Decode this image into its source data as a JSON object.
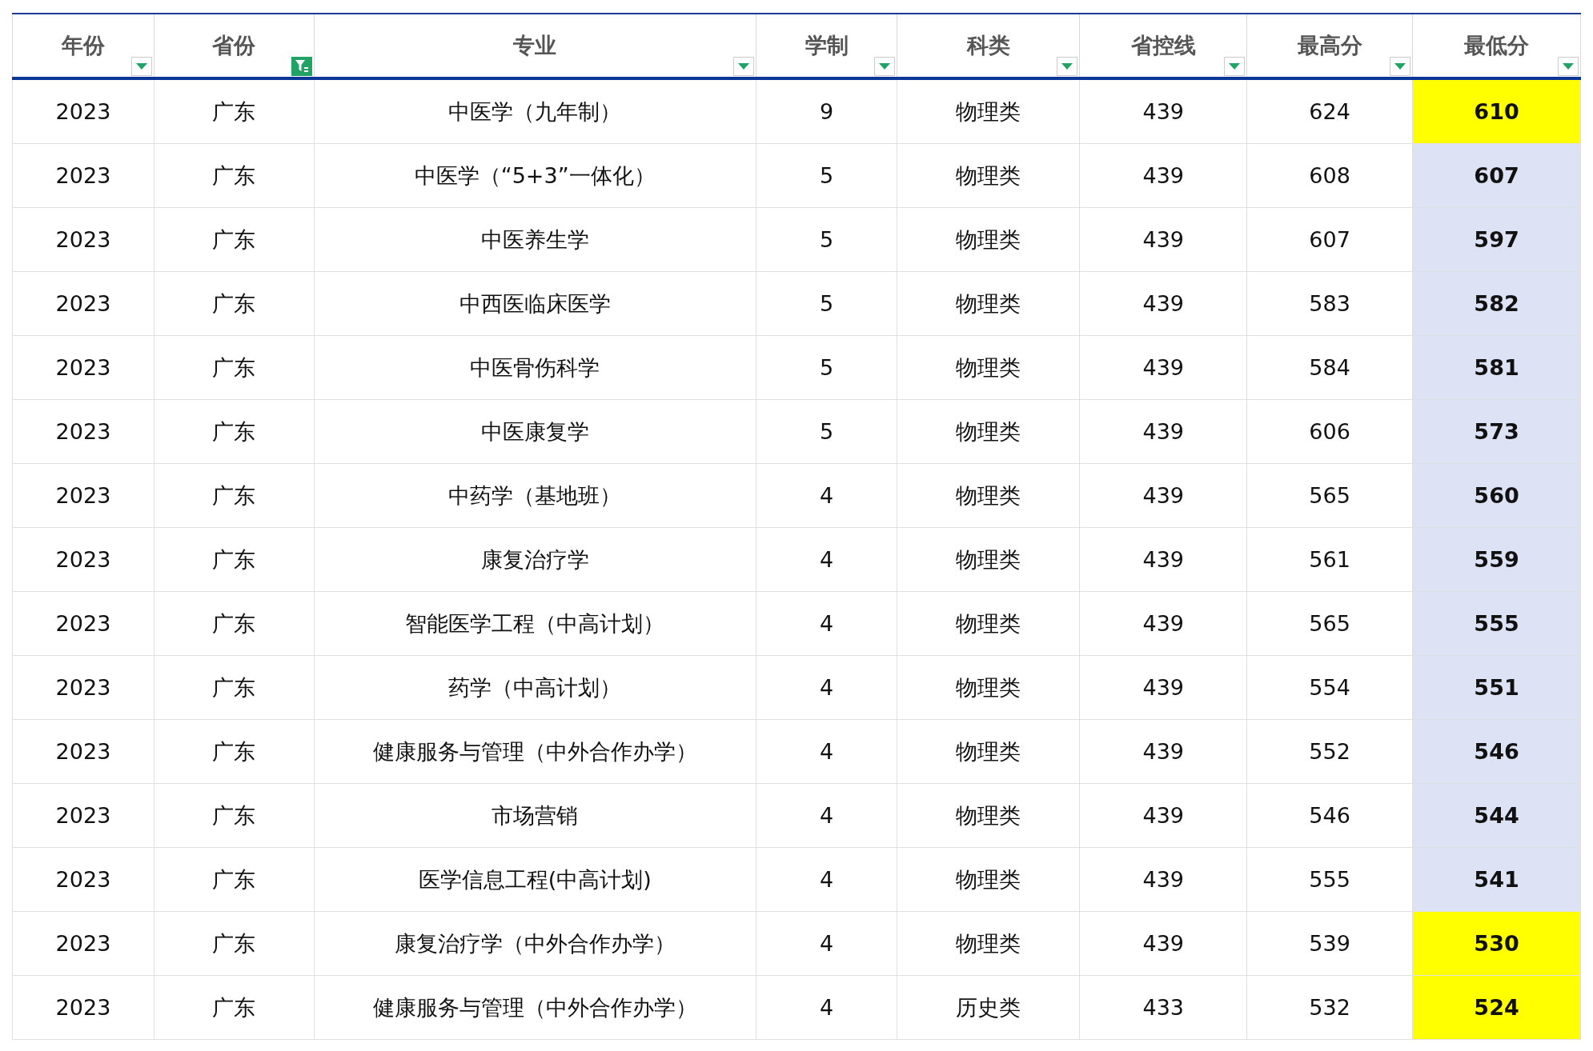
{
  "table": {
    "columns": [
      {
        "label": "年份",
        "filter_active": false
      },
      {
        "label": "省份",
        "filter_active": true
      },
      {
        "label": "专业",
        "filter_active": false
      },
      {
        "label": "学制",
        "filter_active": false
      },
      {
        "label": "科类",
        "filter_active": false
      },
      {
        "label": "省控线",
        "filter_active": false
      },
      {
        "label": "最高分",
        "filter_active": false
      },
      {
        "label": "最低分",
        "filter_active": false
      }
    ],
    "rows": [
      {
        "cells": [
          "2023",
          "广东",
          "中医学（九年制）",
          "9",
          "物理类",
          "439",
          "624",
          "610"
        ],
        "color": "#ffff00"
      },
      {
        "cells": [
          "2023",
          "广东",
          "中医学（“5+3”一体化）",
          "5",
          "物理类",
          "439",
          "608",
          "607"
        ],
        "color": "#dde3f5"
      },
      {
        "cells": [
          "2023",
          "广东",
          "中医养生学",
          "5",
          "物理类",
          "439",
          "607",
          "597"
        ],
        "color": "#dde3f5"
      },
      {
        "cells": [
          "2023",
          "广东",
          "中西医临床医学",
          "5",
          "物理类",
          "439",
          "583",
          "582"
        ],
        "color": "#dde3f5"
      },
      {
        "cells": [
          "2023",
          "广东",
          "中医骨伤科学",
          "5",
          "物理类",
          "439",
          "584",
          "581"
        ],
        "color": "#dde3f5"
      },
      {
        "cells": [
          "2023",
          "广东",
          "中医康复学",
          "5",
          "物理类",
          "439",
          "606",
          "573"
        ],
        "color": "#dde3f5"
      },
      {
        "cells": [
          "2023",
          "广东",
          "中药学（基地班）",
          "4",
          "物理类",
          "439",
          "565",
          "560"
        ],
        "color": "#dde3f5"
      },
      {
        "cells": [
          "2023",
          "广东",
          "康复治疗学",
          "4",
          "物理类",
          "439",
          "561",
          "559"
        ],
        "color": "#dde3f5"
      },
      {
        "cells": [
          "2023",
          "广东",
          "智能医学工程（中高计划）",
          "4",
          "物理类",
          "439",
          "565",
          "555"
        ],
        "color": "#dde3f5"
      },
      {
        "cells": [
          "2023",
          "广东",
          "药学（中高计划）",
          "4",
          "物理类",
          "439",
          "554",
          "551"
        ],
        "color": "#dde3f5"
      },
      {
        "cells": [
          "2023",
          "广东",
          "健康服务与管理（中外合作办学）",
          "4",
          "物理类",
          "439",
          "552",
          "546"
        ],
        "color": "#dde3f5"
      },
      {
        "cells": [
          "2023",
          "广东",
          "市场营销",
          "4",
          "物理类",
          "439",
          "546",
          "544"
        ],
        "color": "#dde3f5"
      },
      {
        "cells": [
          "2023",
          "广东",
          "医学信息工程(中高计划)",
          "4",
          "物理类",
          "439",
          "555",
          "541"
        ],
        "color": "#dde3f5"
      },
      {
        "cells": [
          "2023",
          "广东",
          "康复治疗学（中外合作办学）",
          "4",
          "物理类",
          "439",
          "539",
          "530"
        ],
        "color": "#ffff00"
      },
      {
        "cells": [
          "2023",
          "广东",
          "健康服务与管理（中外合作办学）",
          "4",
          "历史类",
          "433",
          "532",
          "524"
        ],
        "color": "#ffff00"
      }
    ]
  }
}
